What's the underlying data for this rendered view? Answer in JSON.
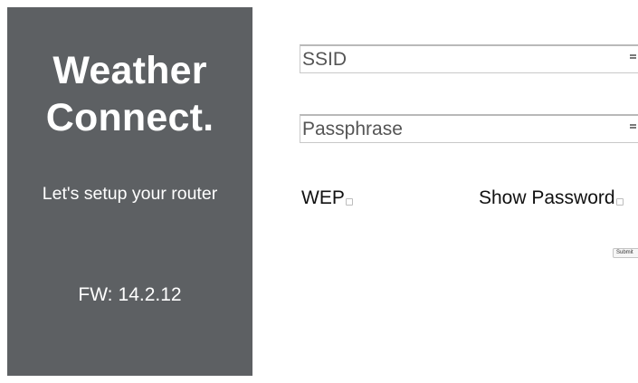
{
  "brand": {
    "title_line1": "Weather",
    "title_line2": "Connect.",
    "subtitle": "Let's setup your router",
    "firmware_label": "FW:",
    "firmware_version": "14.2.12",
    "panel_color": "#5d6063"
  },
  "form": {
    "ssid": {
      "placeholder": "SSID",
      "value": "",
      "icon": "list-icon"
    },
    "passphrase": {
      "placeholder": "Passphrase",
      "value": "",
      "icon": "list-icon"
    },
    "wep": {
      "label": "WEP",
      "checked": false
    },
    "show_password": {
      "label": "Show Password",
      "checked": false
    },
    "submit_label": "Submit"
  }
}
